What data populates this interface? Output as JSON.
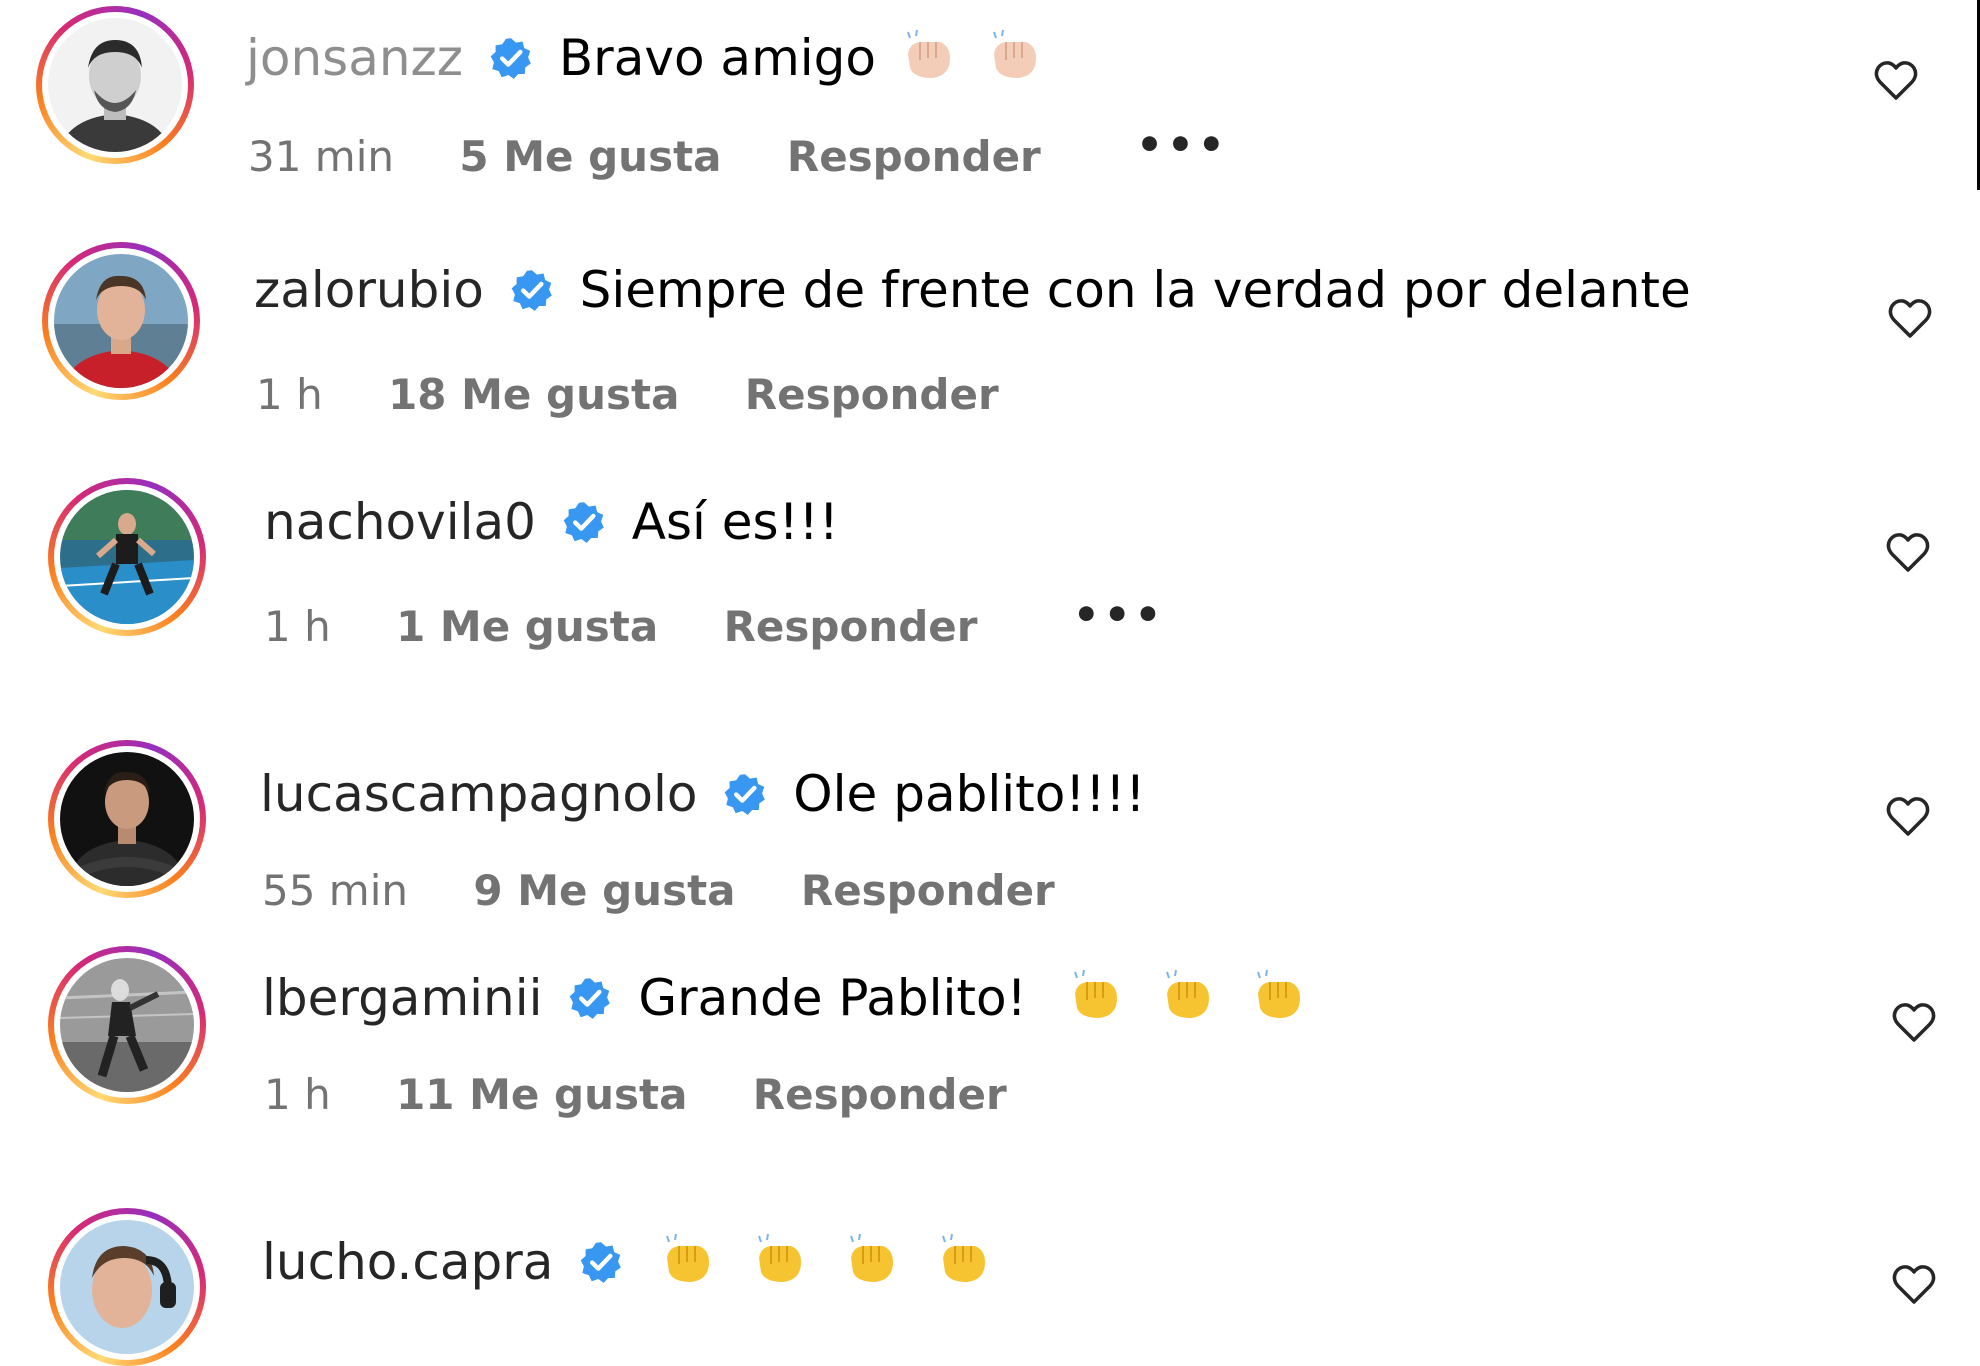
{
  "comments": [
    {
      "username": "jonsanzz",
      "text": "Bravo amigo",
      "time": "31 min",
      "likes": "5 Me gusta",
      "reply": "Responder",
      "more": "•••",
      "emojis": [
        "clapping-hands-light",
        "clapping-hands-light"
      ],
      "avatar": "grayscale-portrait"
    },
    {
      "username": "zalorubio",
      "text": "Siempre de frente con la verdad por delante",
      "time": "1 h",
      "likes": "18 Me gusta",
      "reply": "Responder",
      "avatar": "portrait-red-shirt"
    },
    {
      "username": "nachovila0",
      "text": "Así es!!!",
      "time": "1 h",
      "likes": "1 Me gusta",
      "reply": "Responder",
      "more": "•••",
      "avatar": "padel-court-player"
    },
    {
      "username": "lucascampagnolo",
      "text": "Ole pablito!!!!",
      "time": "55 min",
      "likes": "9 Me gusta",
      "reply": "Responder",
      "avatar": "dark-portrait"
    },
    {
      "username": "lbergaminii",
      "text": "Grande Pablito!",
      "time": "1 h",
      "likes": "11 Me gusta",
      "reply": "Responder",
      "emojis": [
        "clapping-hands-yellow",
        "clapping-hands-yellow",
        "clapping-hands-yellow"
      ],
      "avatar": "grayscale-player-action"
    },
    {
      "username": "lucho.capra",
      "text": "",
      "emojis": [
        "clapping-hands-yellow",
        "clapping-hands-yellow",
        "clapping-hands-yellow",
        "clapping-hands-yellow"
      ],
      "avatar": "portrait-headphones"
    }
  ],
  "colors": {
    "verified_badge": "#3897f0",
    "meta_text": "#737373",
    "clap_yellow": "#f7c431",
    "clap_light": "#f3cdb8"
  },
  "icons": {
    "like": "heart-outline-icon",
    "verified": "verified-badge-icon"
  }
}
